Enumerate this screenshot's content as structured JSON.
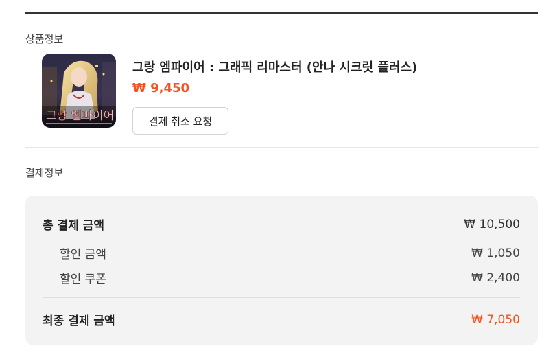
{
  "sections": {
    "product_label": "상품정보",
    "payment_label": "결제정보"
  },
  "product": {
    "title": "그랑 엠파이어 : 그래픽 리마스터 (안나 시크릿 플러스)",
    "price": "₩ 9,450",
    "cancel_button": "결제 취소 요청",
    "thumbnail_logo_text": "그랑 엠파이어"
  },
  "payment": {
    "total_label": "총 결제 금액",
    "total_value": "₩ 10,500",
    "discount_label": "할인 금액",
    "discount_value": "₩ 1,050",
    "coupon_label": "할인 쿠폰",
    "coupon_value": "₩ 2,400",
    "final_label": "최종 결제 금액",
    "final_value": "₩ 7,050"
  },
  "colors": {
    "accent": "#f2531f",
    "panel_bg": "#f3f3f3",
    "top_rule": "#333333"
  }
}
